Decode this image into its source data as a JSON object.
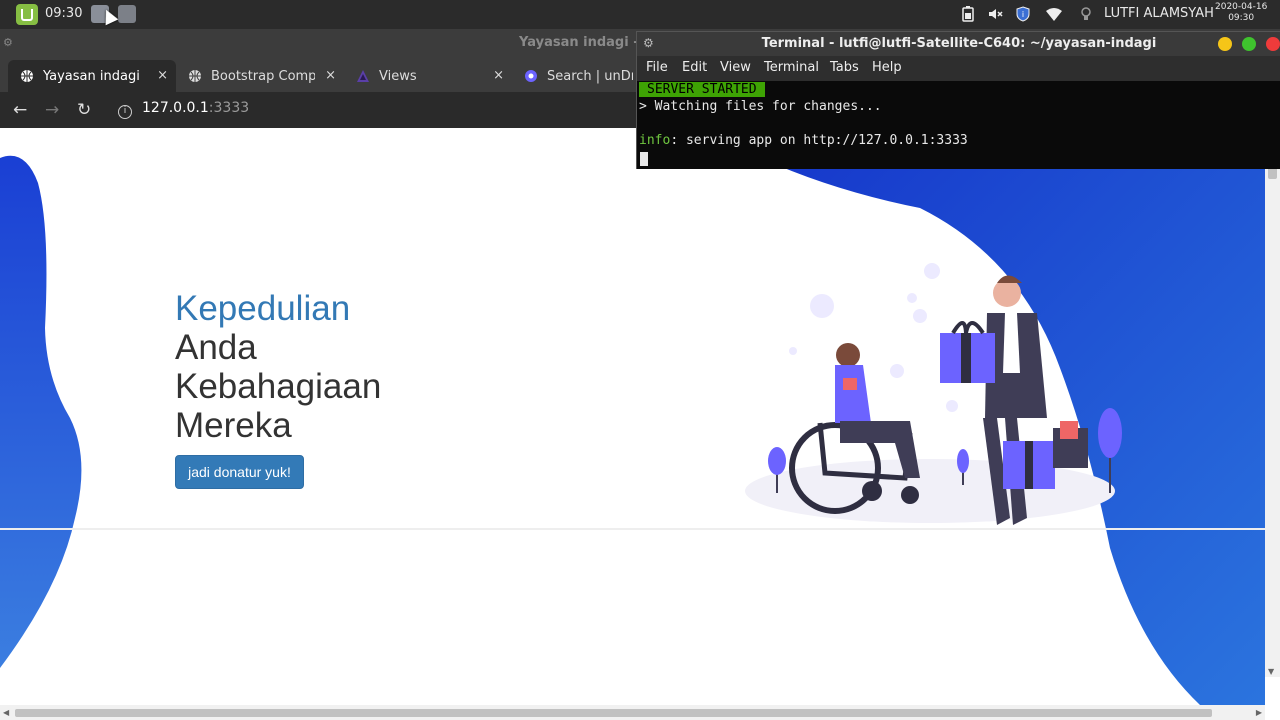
{
  "taskbar": {
    "time": "09:30",
    "user": "LUTFI ALAMSYAH",
    "date": "2020-04-16",
    "date_time": "09:30"
  },
  "browser": {
    "window_title": "Yayasan indagi -",
    "tabs": [
      {
        "label": "Yayasan indagi",
        "icon": "globe-icon",
        "close": "×"
      },
      {
        "label": "Bootstrap Compo",
        "icon": "globe-icon",
        "close": "×"
      },
      {
        "label": "Views",
        "icon": "adonis-triangle-icon",
        "close": "×"
      },
      {
        "label": "Search | unDra",
        "icon": "undraw-icon",
        "close": ""
      }
    ],
    "url_host": "127.0.0.1",
    "url_port": ":3333"
  },
  "page": {
    "hero_accent": "Kepedulian",
    "hero_lines": [
      "Anda",
      "Kebahagiaan",
      "Mereka"
    ],
    "cta_label": "jadi donatur yuk!",
    "colors": {
      "blob": "#1a3fd4",
      "blob_light": "#3b7ee0",
      "accent": "#3379b5",
      "button": "#337ab7"
    }
  },
  "terminal": {
    "title": "Terminal - lutfi@lutfi-Satellite-C640: ~/yayasan-indagi",
    "menu": [
      "File",
      "Edit",
      "View",
      "Terminal",
      "Tabs",
      "Help"
    ],
    "badge": "SERVER STARTED",
    "watching": "> Watching files for changes...",
    "info_prefix": "info",
    "info_rest": ": serving app on http://127.0.0.1:3333"
  }
}
